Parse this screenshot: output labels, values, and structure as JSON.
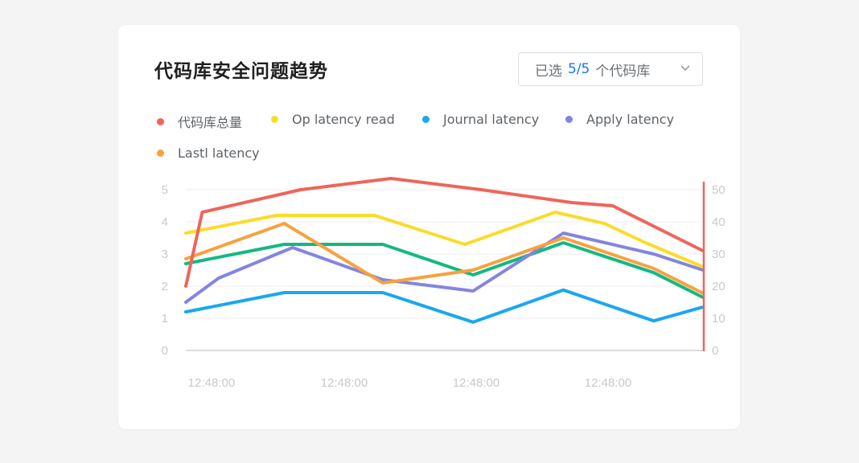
{
  "title": "代码库安全问题趋势",
  "selector": {
    "prefix": "已选",
    "count": "5/5",
    "suffix": "个代码库"
  },
  "colors": {
    "accent": "#1677ff",
    "right_axis": "#f0645a"
  },
  "chart_data": {
    "type": "line",
    "categories": [
      "12:48:00",
      "12:48:00",
      "12:48:00",
      "12:48:00",
      "12:48:00",
      "12:48:00",
      "12:48:00",
      "12:48:00",
      "12:48:00",
      "12:48:00"
    ],
    "x_tick_labels": [
      "12:48:00",
      "12:48:00",
      "12:48:00",
      "12:48:00"
    ],
    "y_left": {
      "ticks": [
        "0",
        "1",
        "2",
        "3",
        "4",
        "5"
      ],
      "range": [
        0,
        5
      ]
    },
    "y_right": {
      "ticks": [
        "0",
        "10",
        "20",
        "30",
        "40",
        "50"
      ],
      "range": [
        0,
        50
      ]
    },
    "grid": true,
    "legend_position": "top-left",
    "series": [
      {
        "name": "代码库总量",
        "color": "#f0645a",
        "axis": "left",
        "x": [
          0,
          0.2,
          1.4,
          2.5,
          3.6,
          4.7,
          5.2,
          6.3
        ],
        "values": [
          2.0,
          4.3,
          5.0,
          5.35,
          5.0,
          4.6,
          4.5,
          3.1
        ]
      },
      {
        "name": "Op latency read",
        "color": "#fadc28",
        "axis": "left",
        "x": [
          0,
          1.1,
          2.3,
          3.4,
          4.5,
          5.1,
          5.6,
          6.3
        ],
        "values": [
          3.65,
          4.2,
          4.2,
          3.3,
          4.3,
          3.95,
          3.35,
          2.6
        ]
      },
      {
        "name": "Journal latency",
        "color": "#1aa7ef",
        "axis": "left",
        "x": [
          0,
          1.2,
          2.4,
          3.5,
          4.6,
          5.7,
          6.3
        ],
        "values": [
          1.2,
          1.8,
          1.8,
          0.88,
          1.88,
          0.92,
          1.35
        ]
      },
      {
        "name": "Apply latency",
        "color": "#8385e0",
        "axis": "left",
        "x": [
          0,
          0.4,
          1.3,
          2.4,
          3.5,
          4.6,
          5.7,
          6.3
        ],
        "values": [
          1.5,
          2.25,
          3.2,
          2.2,
          1.85,
          3.65,
          3.0,
          2.5
        ]
      },
      {
        "name": "Lastl latency",
        "color": "#f8a13f",
        "axis": "left",
        "x": [
          0,
          1.2,
          2.4,
          3.5,
          4.6,
          5.7,
          6.3
        ],
        "values": [
          2.85,
          3.95,
          2.1,
          2.5,
          3.5,
          2.55,
          1.78
        ]
      },
      {
        "name": "",
        "color": "#12b980",
        "axis": "left",
        "x": [
          0,
          1.2,
          2.4,
          3.5,
          4.6,
          5.7,
          6.3
        ],
        "values": [
          2.7,
          3.3,
          3.3,
          2.35,
          3.35,
          2.42,
          1.65
        ]
      }
    ]
  }
}
